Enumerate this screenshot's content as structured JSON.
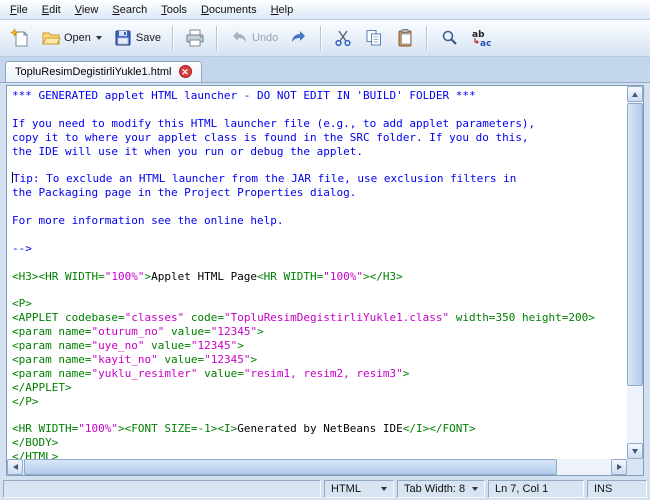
{
  "menu": {
    "items": [
      {
        "label": "File",
        "underline": 0
      },
      {
        "label": "Edit",
        "underline": 0
      },
      {
        "label": "View",
        "underline": 0
      },
      {
        "label": "Search",
        "underline": 0
      },
      {
        "label": "Tools",
        "underline": 0
      },
      {
        "label": "Documents",
        "underline": 0
      },
      {
        "label": "Help",
        "underline": 0
      }
    ]
  },
  "toolbar": {
    "open_label": "Open",
    "save_label": "Save",
    "undo_label": "Undo"
  },
  "tab": {
    "title": "TopluResimDegistirliYukle1.html"
  },
  "editor": {
    "colors": {
      "comment": "#0000f0",
      "tag": "#008000",
      "value": "#c800c8",
      "text": "#000000"
    },
    "lines": [
      {
        "tokens": [
          {
            "c": "comment",
            "t": "*** GENERATED applet HTML launcher - DO NOT EDIT IN 'BUILD' FOLDER ***"
          }
        ]
      },
      {
        "tokens": []
      },
      {
        "tokens": [
          {
            "c": "comment",
            "t": "If you need to modify this HTML launcher file (e.g., to add applet parameters),"
          }
        ]
      },
      {
        "tokens": [
          {
            "c": "comment",
            "t": "copy it to where your applet class is found in the SRC folder. If you do this,"
          }
        ]
      },
      {
        "tokens": [
          {
            "c": "comment",
            "t": "the IDE will use it when you run or debug the applet."
          }
        ]
      },
      {
        "tokens": []
      },
      {
        "caret": true,
        "tokens": [
          {
            "c": "comment",
            "t": "Tip: To exclude an HTML launcher from the JAR file, use exclusion filters in"
          }
        ]
      },
      {
        "tokens": [
          {
            "c": "comment",
            "t": "the Packaging page in the Project Properties dialog."
          }
        ]
      },
      {
        "tokens": []
      },
      {
        "tokens": [
          {
            "c": "comment",
            "t": "For more information see the online help."
          }
        ]
      },
      {
        "tokens": []
      },
      {
        "tokens": [
          {
            "c": "comment",
            "t": "-->"
          }
        ]
      },
      {
        "tokens": []
      },
      {
        "tokens": [
          {
            "c": "tag",
            "t": "<H3><HR WIDTH="
          },
          {
            "c": "value",
            "t": "\"100%\""
          },
          {
            "c": "tag",
            "t": ">"
          },
          {
            "c": "text",
            "t": "Applet HTML Page"
          },
          {
            "c": "tag",
            "t": "<HR WIDTH="
          },
          {
            "c": "value",
            "t": "\"100%\""
          },
          {
            "c": "tag",
            "t": "></H3>"
          }
        ]
      },
      {
        "tokens": []
      },
      {
        "tokens": [
          {
            "c": "tag",
            "t": "<P>"
          }
        ]
      },
      {
        "tokens": [
          {
            "c": "tag",
            "t": "<APPLET codebase="
          },
          {
            "c": "value",
            "t": "\"classes\""
          },
          {
            "c": "tag",
            "t": " code="
          },
          {
            "c": "value",
            "t": "\"TopluResimDegistirliYukle1.class\""
          },
          {
            "c": "tag",
            "t": " width=350 height=200>"
          }
        ]
      },
      {
        "tokens": [
          {
            "c": "tag",
            "t": "<param name="
          },
          {
            "c": "value",
            "t": "\"oturum_no\""
          },
          {
            "c": "tag",
            "t": " value="
          },
          {
            "c": "value",
            "t": "\"12345\""
          },
          {
            "c": "tag",
            "t": ">"
          }
        ]
      },
      {
        "tokens": [
          {
            "c": "tag",
            "t": "<param name="
          },
          {
            "c": "value",
            "t": "\"uye_no\""
          },
          {
            "c": "tag",
            "t": " value="
          },
          {
            "c": "value",
            "t": "\"12345\""
          },
          {
            "c": "tag",
            "t": ">"
          }
        ]
      },
      {
        "tokens": [
          {
            "c": "tag",
            "t": "<param name="
          },
          {
            "c": "value",
            "t": "\"kayit_no\""
          },
          {
            "c": "tag",
            "t": " value="
          },
          {
            "c": "value",
            "t": "\"12345\""
          },
          {
            "c": "tag",
            "t": ">"
          }
        ]
      },
      {
        "tokens": [
          {
            "c": "tag",
            "t": "<param name="
          },
          {
            "c": "value",
            "t": "\"yuklu_resimler\""
          },
          {
            "c": "tag",
            "t": " value="
          },
          {
            "c": "value",
            "t": "\"resim1, resim2, resim3\""
          },
          {
            "c": "tag",
            "t": ">"
          }
        ]
      },
      {
        "tokens": [
          {
            "c": "tag",
            "t": "</APPLET>"
          }
        ]
      },
      {
        "tokens": [
          {
            "c": "tag",
            "t": "</P>"
          }
        ]
      },
      {
        "tokens": []
      },
      {
        "tokens": [
          {
            "c": "tag",
            "t": "<HR WIDTH="
          },
          {
            "c": "value",
            "t": "\"100%\""
          },
          {
            "c": "tag",
            "t": "><FONT SIZE=-1><I>"
          },
          {
            "c": "text",
            "t": "Generated by NetBeans IDE"
          },
          {
            "c": "tag",
            "t": "</I></FONT>"
          }
        ]
      },
      {
        "tokens": [
          {
            "c": "tag",
            "t": "</BODY>"
          }
        ]
      },
      {
        "tokens": [
          {
            "c": "tag",
            "t": "</HTML>"
          }
        ]
      }
    ]
  },
  "statusbar": {
    "message": "",
    "mode": "HTML",
    "tab_width": "Tab Width: 8",
    "position": "Ln 7, Col 1",
    "insert_mode": "INS"
  }
}
